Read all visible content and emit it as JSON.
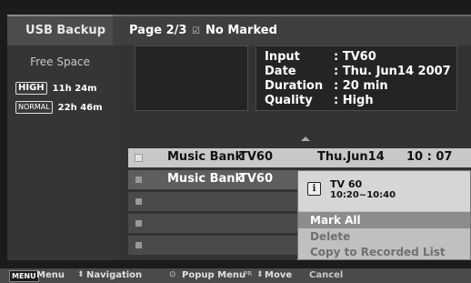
{
  "left_panel": {
    "tab_label": "USB Backup",
    "free_space_label": "Free Space",
    "modes": [
      {
        "badge": "HIGH",
        "time": "11h 24m"
      },
      {
        "badge": "NORMAL",
        "time": "22h 46m"
      }
    ]
  },
  "header": {
    "page": "Page 2/3",
    "mark_icon": "☑",
    "mark_status": "No Marked"
  },
  "info": {
    "input_label": "Input",
    "input_value": ": TV60",
    "date_label": "Date",
    "date_value": ": Thu. Jun14 2007",
    "duration_label": "Duration",
    "duration_value": ": 20 min",
    "quality_label": "Quality",
    "quality_value": ": High"
  },
  "list": {
    "rows": [
      {
        "title": "Music Bank",
        "channel": "TV60",
        "date": "Thu.Jun14",
        "time": "10 : 07"
      },
      {
        "title": "Music Bank",
        "channel": "TV60",
        "date": "",
        "time": ""
      }
    ]
  },
  "popup": {
    "channel": "TV 60",
    "time_range": "10:20~10:40",
    "items": [
      "Mark All",
      "Delete",
      "Copy to Recorded List",
      "Cancel"
    ]
  },
  "footer": {
    "menu_key": "MENU",
    "menu_label": "Menu",
    "nav_label": "Navigation",
    "popup_label": "Popup Menu",
    "move_key": "PR",
    "move_label": "Move"
  },
  "colors": {
    "selected_row": "#c8c8c8",
    "panel": "#353535",
    "popup_selected": "#8c8c8c"
  }
}
